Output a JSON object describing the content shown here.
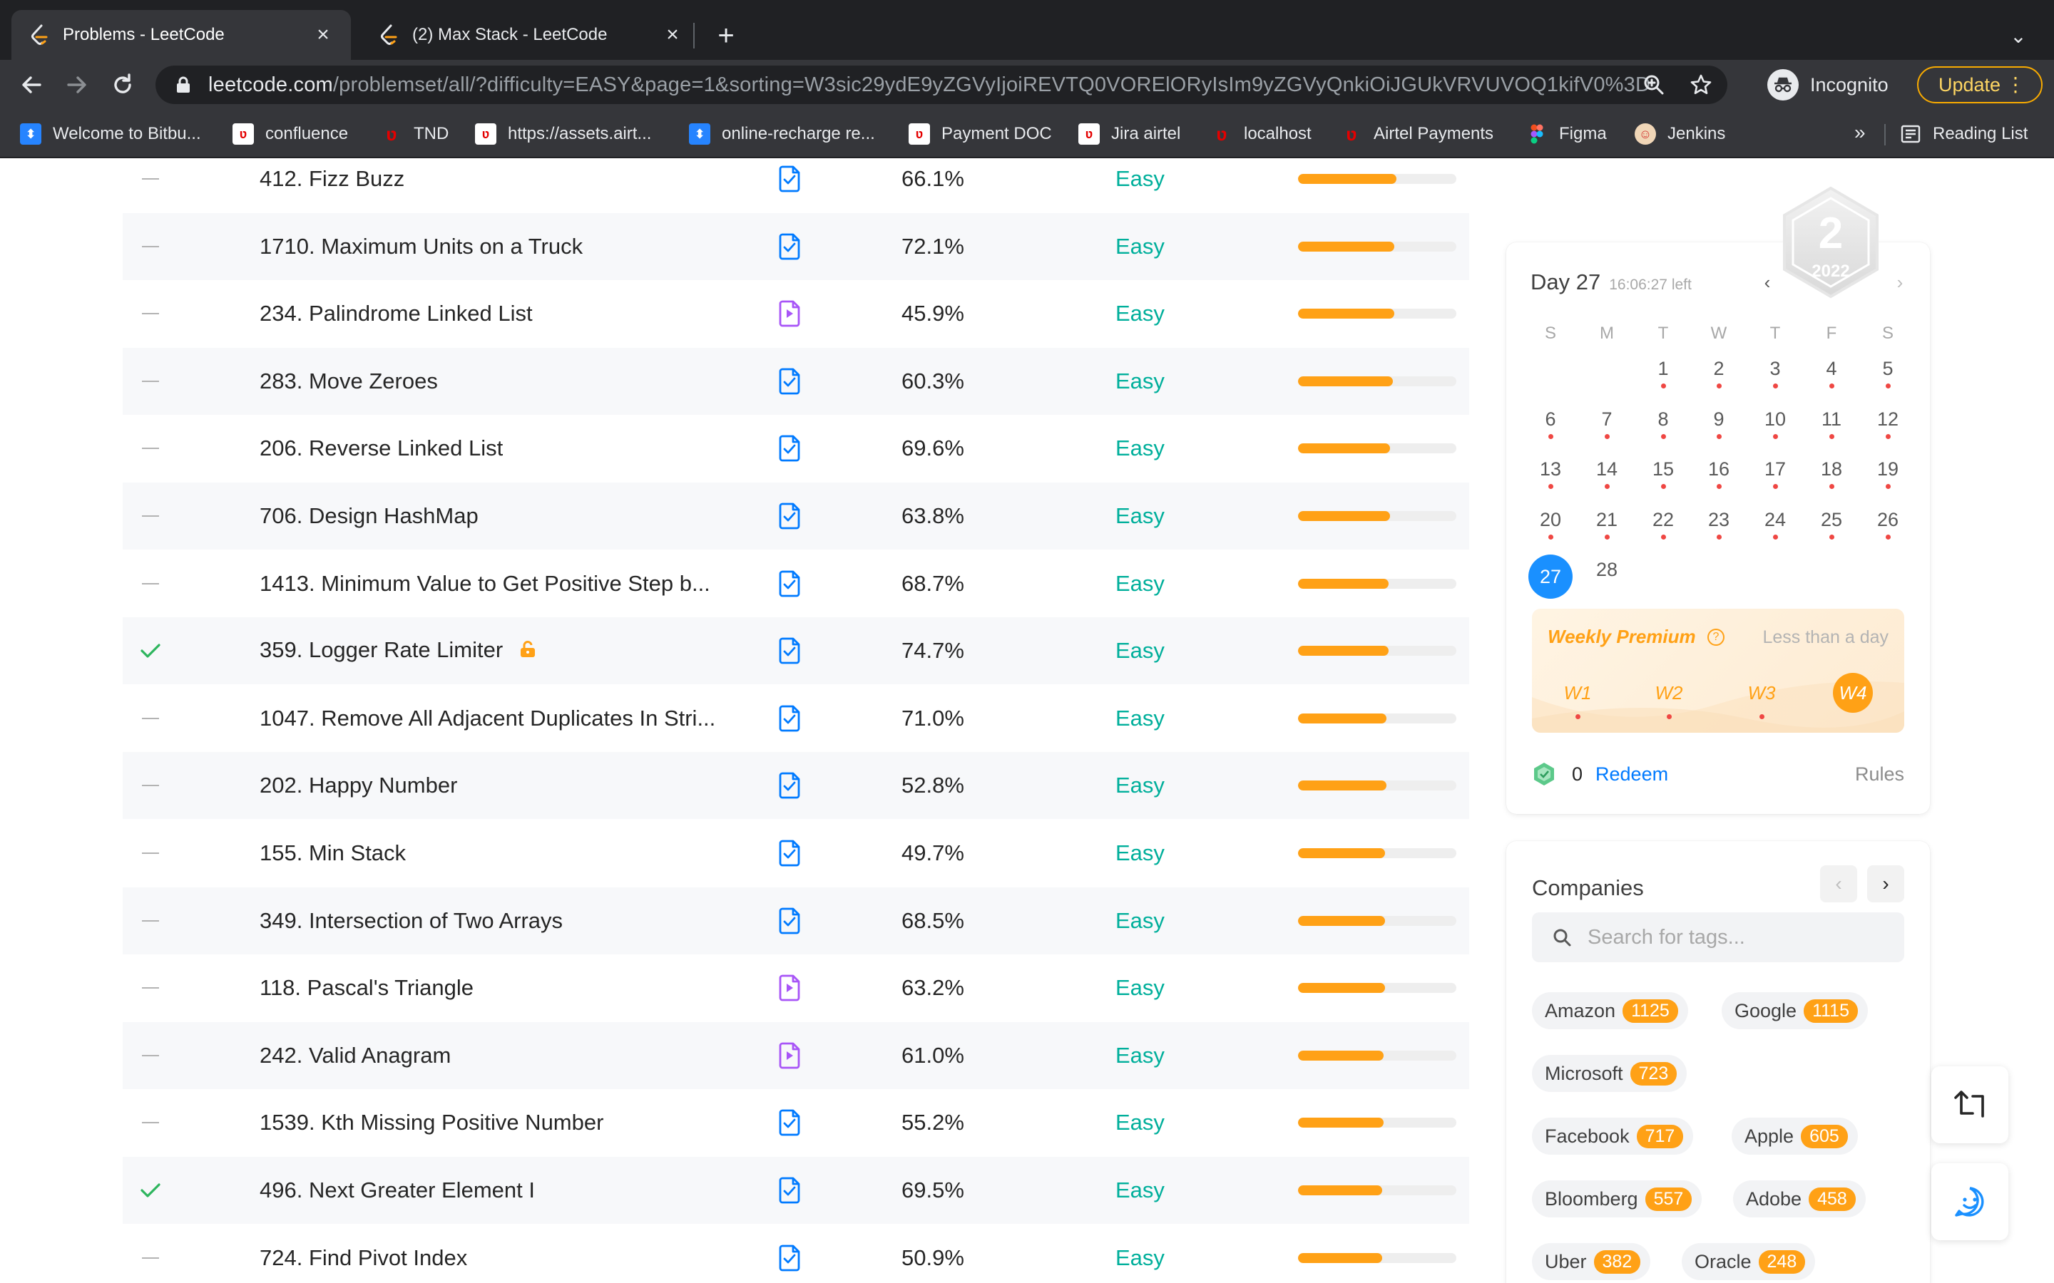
{
  "browser": {
    "tabs": [
      {
        "title": "Problems - LeetCode",
        "active": true
      },
      {
        "title": "(2) Max Stack - LeetCode",
        "active": false
      }
    ],
    "url_host": "leetcode.com",
    "url_path": "/problemset/all/?difficulty=EASY&page=1&sorting=W3sic29ydE9yZGVyIjoiREVTQ0VORElORyIsIm9yZGVyQnkiOiJGUkVRVUVOQ1kifV0%3D",
    "profile_label": "Incognito",
    "update_label": "Update",
    "bookmarks": [
      {
        "label": "Welcome to Bitbu...",
        "icon": "bitbucket-icon",
        "color": "#2684ff"
      },
      {
        "label": "confluence",
        "icon": "airtel-icon",
        "color": "#e40000"
      },
      {
        "label": "TND",
        "icon": "airtel-icon",
        "color": "#e40000"
      },
      {
        "label": "https://assets.airt...",
        "icon": "airtel-icon",
        "color": "#e40000"
      },
      {
        "label": "online-recharge re...",
        "icon": "bitbucket-icon",
        "color": "#2684ff"
      },
      {
        "label": "Payment DOC",
        "icon": "airtel-icon",
        "color": "#e40000"
      },
      {
        "label": "Jira airtel",
        "icon": "airtel-icon",
        "color": "#e40000"
      },
      {
        "label": "localhost",
        "icon": "airtel-icon",
        "color": "#e40000"
      },
      {
        "label": "Airtel Payments",
        "icon": "airtel-icon",
        "color": "#e40000"
      },
      {
        "label": "Figma",
        "icon": "figma-icon",
        "color": "#a259ff"
      },
      {
        "label": "Jenkins",
        "icon": "jenkins-icon",
        "color": "#d33833"
      }
    ],
    "more_bookmarks": "»",
    "reading_list": "Reading List"
  },
  "problems": [
    {
      "status": "none",
      "title": "412. Fizz Buzz",
      "solution": "article",
      "acceptance": "66.1%",
      "difficulty": "Easy",
      "frequency": 0.62,
      "locked": false
    },
    {
      "status": "none",
      "title": "1710. Maximum Units on a Truck",
      "solution": "article",
      "acceptance": "72.1%",
      "difficulty": "Easy",
      "frequency": 0.61,
      "locked": false
    },
    {
      "status": "none",
      "title": "234. Palindrome Linked List",
      "solution": "video",
      "acceptance": "45.9%",
      "difficulty": "Easy",
      "frequency": 0.61,
      "locked": false
    },
    {
      "status": "none",
      "title": "283. Move Zeroes",
      "solution": "article",
      "acceptance": "60.3%",
      "difficulty": "Easy",
      "frequency": 0.6,
      "locked": false
    },
    {
      "status": "none",
      "title": "206. Reverse Linked List",
      "solution": "article",
      "acceptance": "69.6%",
      "difficulty": "Easy",
      "frequency": 0.58,
      "locked": false
    },
    {
      "status": "none",
      "title": "706. Design HashMap",
      "solution": "article",
      "acceptance": "63.8%",
      "difficulty": "Easy",
      "frequency": 0.58,
      "locked": false
    },
    {
      "status": "none",
      "title": "1413. Minimum Value to Get Positive Step b...",
      "solution": "article",
      "acceptance": "68.7%",
      "difficulty": "Easy",
      "frequency": 0.57,
      "locked": false
    },
    {
      "status": "solved",
      "title": "359. Logger Rate Limiter",
      "solution": "article",
      "acceptance": "74.7%",
      "difficulty": "Easy",
      "frequency": 0.57,
      "locked": true
    },
    {
      "status": "none",
      "title": "1047. Remove All Adjacent Duplicates In Stri...",
      "solution": "article",
      "acceptance": "71.0%",
      "difficulty": "Easy",
      "frequency": 0.56,
      "locked": false
    },
    {
      "status": "none",
      "title": "202. Happy Number",
      "solution": "article",
      "acceptance": "52.8%",
      "difficulty": "Easy",
      "frequency": 0.56,
      "locked": false
    },
    {
      "status": "none",
      "title": "155. Min Stack",
      "solution": "article",
      "acceptance": "49.7%",
      "difficulty": "Easy",
      "frequency": 0.55,
      "locked": false
    },
    {
      "status": "none",
      "title": "349. Intersection of Two Arrays",
      "solution": "article",
      "acceptance": "68.5%",
      "difficulty": "Easy",
      "frequency": 0.55,
      "locked": false
    },
    {
      "status": "none",
      "title": "118. Pascal's Triangle",
      "solution": "video",
      "acceptance": "63.2%",
      "difficulty": "Easy",
      "frequency": 0.55,
      "locked": false
    },
    {
      "status": "none",
      "title": "242. Valid Anagram",
      "solution": "video",
      "acceptance": "61.0%",
      "difficulty": "Easy",
      "frequency": 0.54,
      "locked": false
    },
    {
      "status": "none",
      "title": "1539. Kth Missing Positive Number",
      "solution": "article",
      "acceptance": "55.2%",
      "difficulty": "Easy",
      "frequency": 0.54,
      "locked": false
    },
    {
      "status": "solved",
      "title": "496. Next Greater Element I",
      "solution": "article",
      "acceptance": "69.5%",
      "difficulty": "Easy",
      "frequency": 0.53,
      "locked": false
    },
    {
      "status": "none",
      "title": "724. Find Pivot Index",
      "solution": "article",
      "acceptance": "50.9%",
      "difficulty": "Easy",
      "frequency": 0.53,
      "locked": false
    }
  ],
  "calendar": {
    "day_label": "Day 27",
    "time_left": "16:06:27 left",
    "badge_number": "2",
    "badge_year": "2022",
    "weekdays": [
      "S",
      "M",
      "T",
      "W",
      "T",
      "F",
      "S"
    ],
    "first_weekday": 2,
    "days_in_view": 28,
    "today": 27,
    "missed_days": [
      1,
      2,
      3,
      4,
      5,
      6,
      7,
      8,
      9,
      10,
      11,
      12,
      13,
      14,
      15,
      16,
      17,
      18,
      19,
      20,
      21,
      22,
      23,
      24,
      25,
      26
    ],
    "premium_title": "Weekly Premium",
    "premium_help": "?",
    "premium_time": "Less than a day",
    "weeks": [
      "W1",
      "W2",
      "W3",
      "W4"
    ],
    "current_week": 3,
    "coins": "0",
    "redeem_label": "Redeem",
    "rules_label": "Rules"
  },
  "companies": {
    "title": "Companies",
    "search_placeholder": "Search for tags...",
    "tags": [
      {
        "name": "Amazon",
        "count": "1125"
      },
      {
        "name": "Google",
        "count": "1115"
      },
      {
        "name": "Microsoft",
        "count": "723"
      },
      {
        "name": "Facebook",
        "count": "717"
      },
      {
        "name": "Apple",
        "count": "605"
      },
      {
        "name": "Bloomberg",
        "count": "557"
      },
      {
        "name": "Adobe",
        "count": "458"
      },
      {
        "name": "Uber",
        "count": "382"
      },
      {
        "name": "Oracle",
        "count": "248"
      }
    ]
  },
  "colors": {
    "accent_orange": "#ffa116",
    "easy_green": "#00af9b",
    "link_blue": "#007aff",
    "missed_red": "#ef4743",
    "today_blue": "#1a90ff"
  }
}
